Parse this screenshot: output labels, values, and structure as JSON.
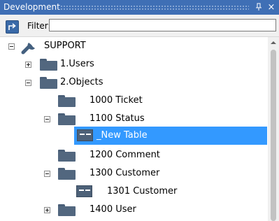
{
  "window": {
    "title": "Development",
    "pin_glyph": "ᵒ",
    "close_glyph": "×"
  },
  "toolbar": {
    "filter_label": "Filter:",
    "filter_value": ""
  },
  "tree": {
    "root": "SUPPORT",
    "users": "1.Users",
    "objects": "2.Objects",
    "ticket": "1000 Ticket",
    "status": "1100 Status",
    "new_table": "_New Table",
    "comment": "1200 Comment",
    "customer": "1300 Customer",
    "customer_child": "1301 Customer",
    "user": "1400 User"
  },
  "colors": {
    "title_bar": "#3f6fb5",
    "selection": "#3399ff",
    "folder": "#52677f"
  }
}
